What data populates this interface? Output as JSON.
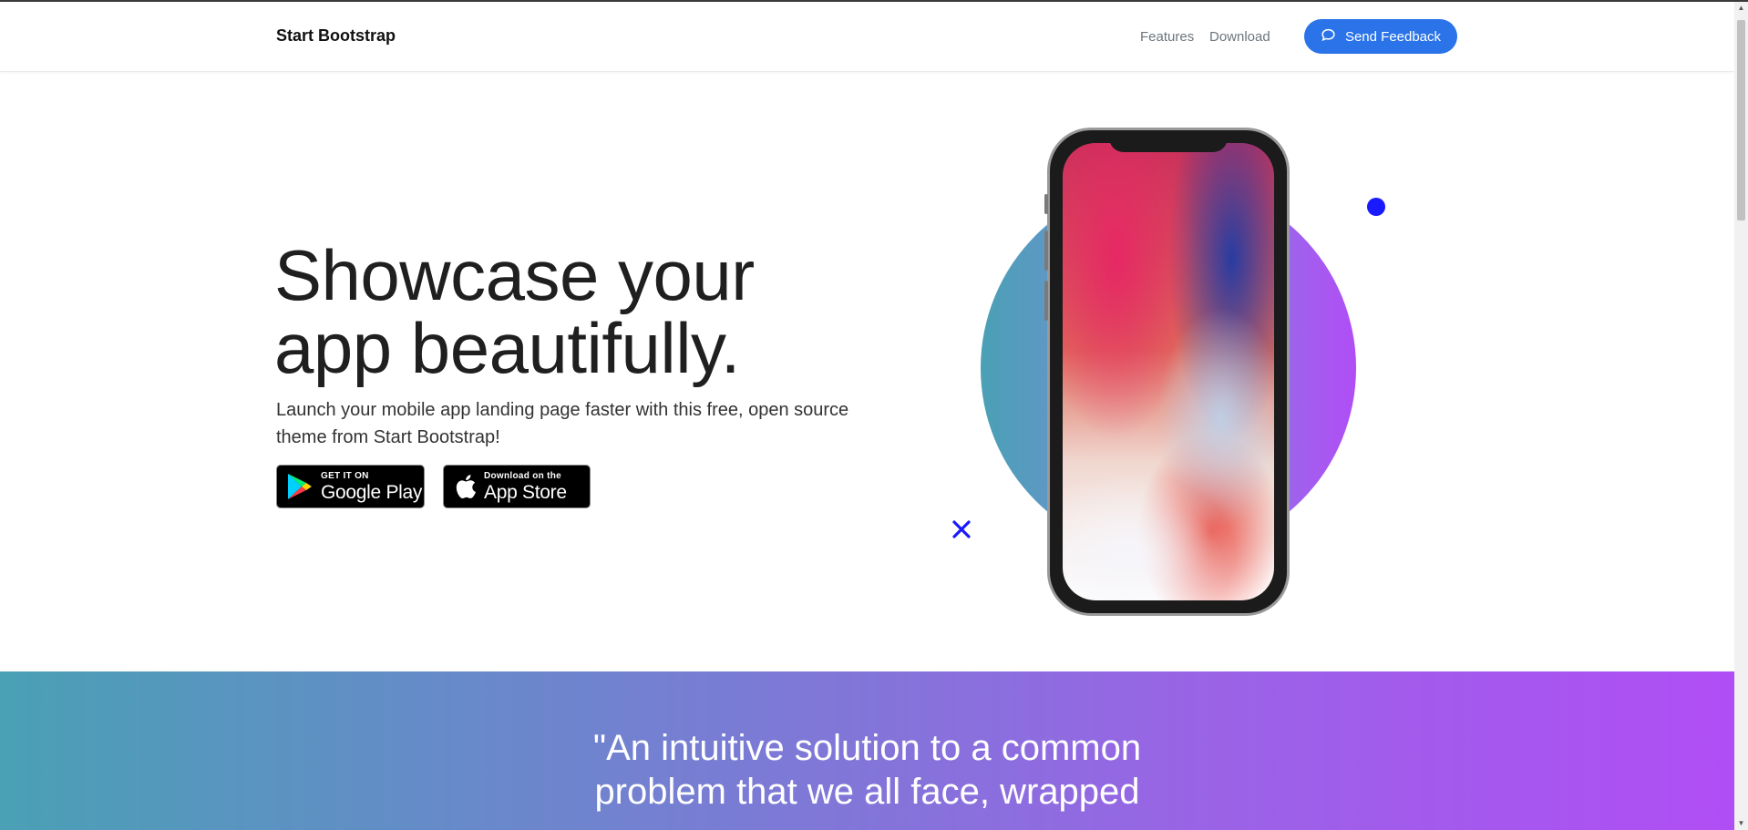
{
  "nav": {
    "brand": "Start Bootstrap",
    "links": [
      "Features",
      "Download"
    ],
    "feedback_label": "Send Feedback",
    "accent": "#2a73e8"
  },
  "hero": {
    "title": "Showcase your\napp beautifully.",
    "subtitle": "Launch your mobile app landing page faster with this free, open source theme from Start Bootstrap!",
    "google_play": {
      "small": "GET IT ON",
      "big": "Google Play",
      "icon": "google-play-icon"
    },
    "app_store": {
      "small": "Download on the",
      "big": "App Store",
      "icon": "apple-icon"
    }
  },
  "decor": {
    "gradient_start": "#4aa0b5",
    "gradient_end": "#b04ef5",
    "dot_color": "#1a1aff"
  },
  "testimonial": {
    "quote": "\"An intuitive solution to a common\nproblem that we all face, wrapped"
  }
}
